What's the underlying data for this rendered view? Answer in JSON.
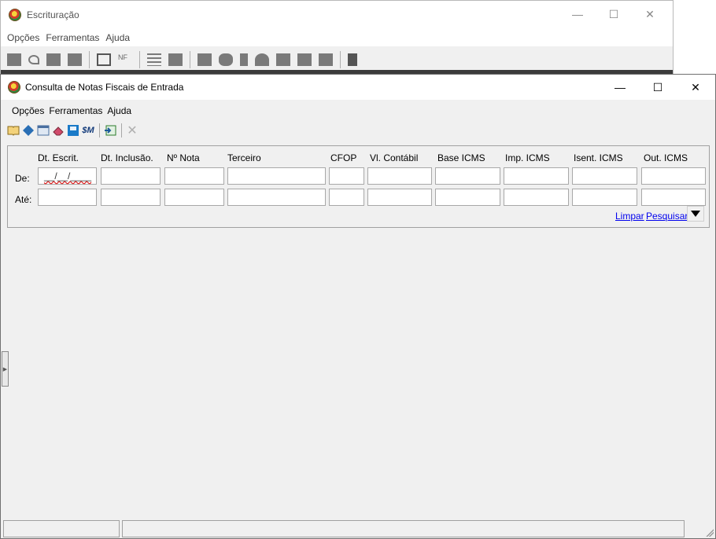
{
  "parent_window": {
    "title": "Escrituração",
    "menu": [
      "Opções",
      "Ferramentas",
      "Ajuda"
    ],
    "controls": {
      "minimize": "—",
      "maximize": "☐",
      "close": "✕"
    }
  },
  "child_window": {
    "title": "Consulta de Notas Fiscais de Entrada",
    "menu": [
      "Opções",
      "Ferramentas",
      "Ajuda"
    ],
    "controls": {
      "minimize": "—",
      "maximize": "☐",
      "close": "✕"
    },
    "toolbar_icons": [
      "book-icon",
      "diamond-icon",
      "window-icon",
      "eraser-icon",
      "save-icon",
      "sm-icon",
      "export-icon",
      "close-icon"
    ]
  },
  "filter": {
    "columns": [
      "Dt. Escrit.",
      "Dt. Inclusão.",
      "Nº Nota",
      "Terceiro",
      "CFOP",
      "Vl. Contábil",
      "Base ICMS",
      "Imp. ICMS",
      "Isent. ICMS",
      "Out. ICMS"
    ],
    "row_from_label": "De:",
    "row_to_label": "Até:",
    "date_mask": "__/__/____",
    "clear_link": "Limpar",
    "search_link": "Pesquisar"
  }
}
